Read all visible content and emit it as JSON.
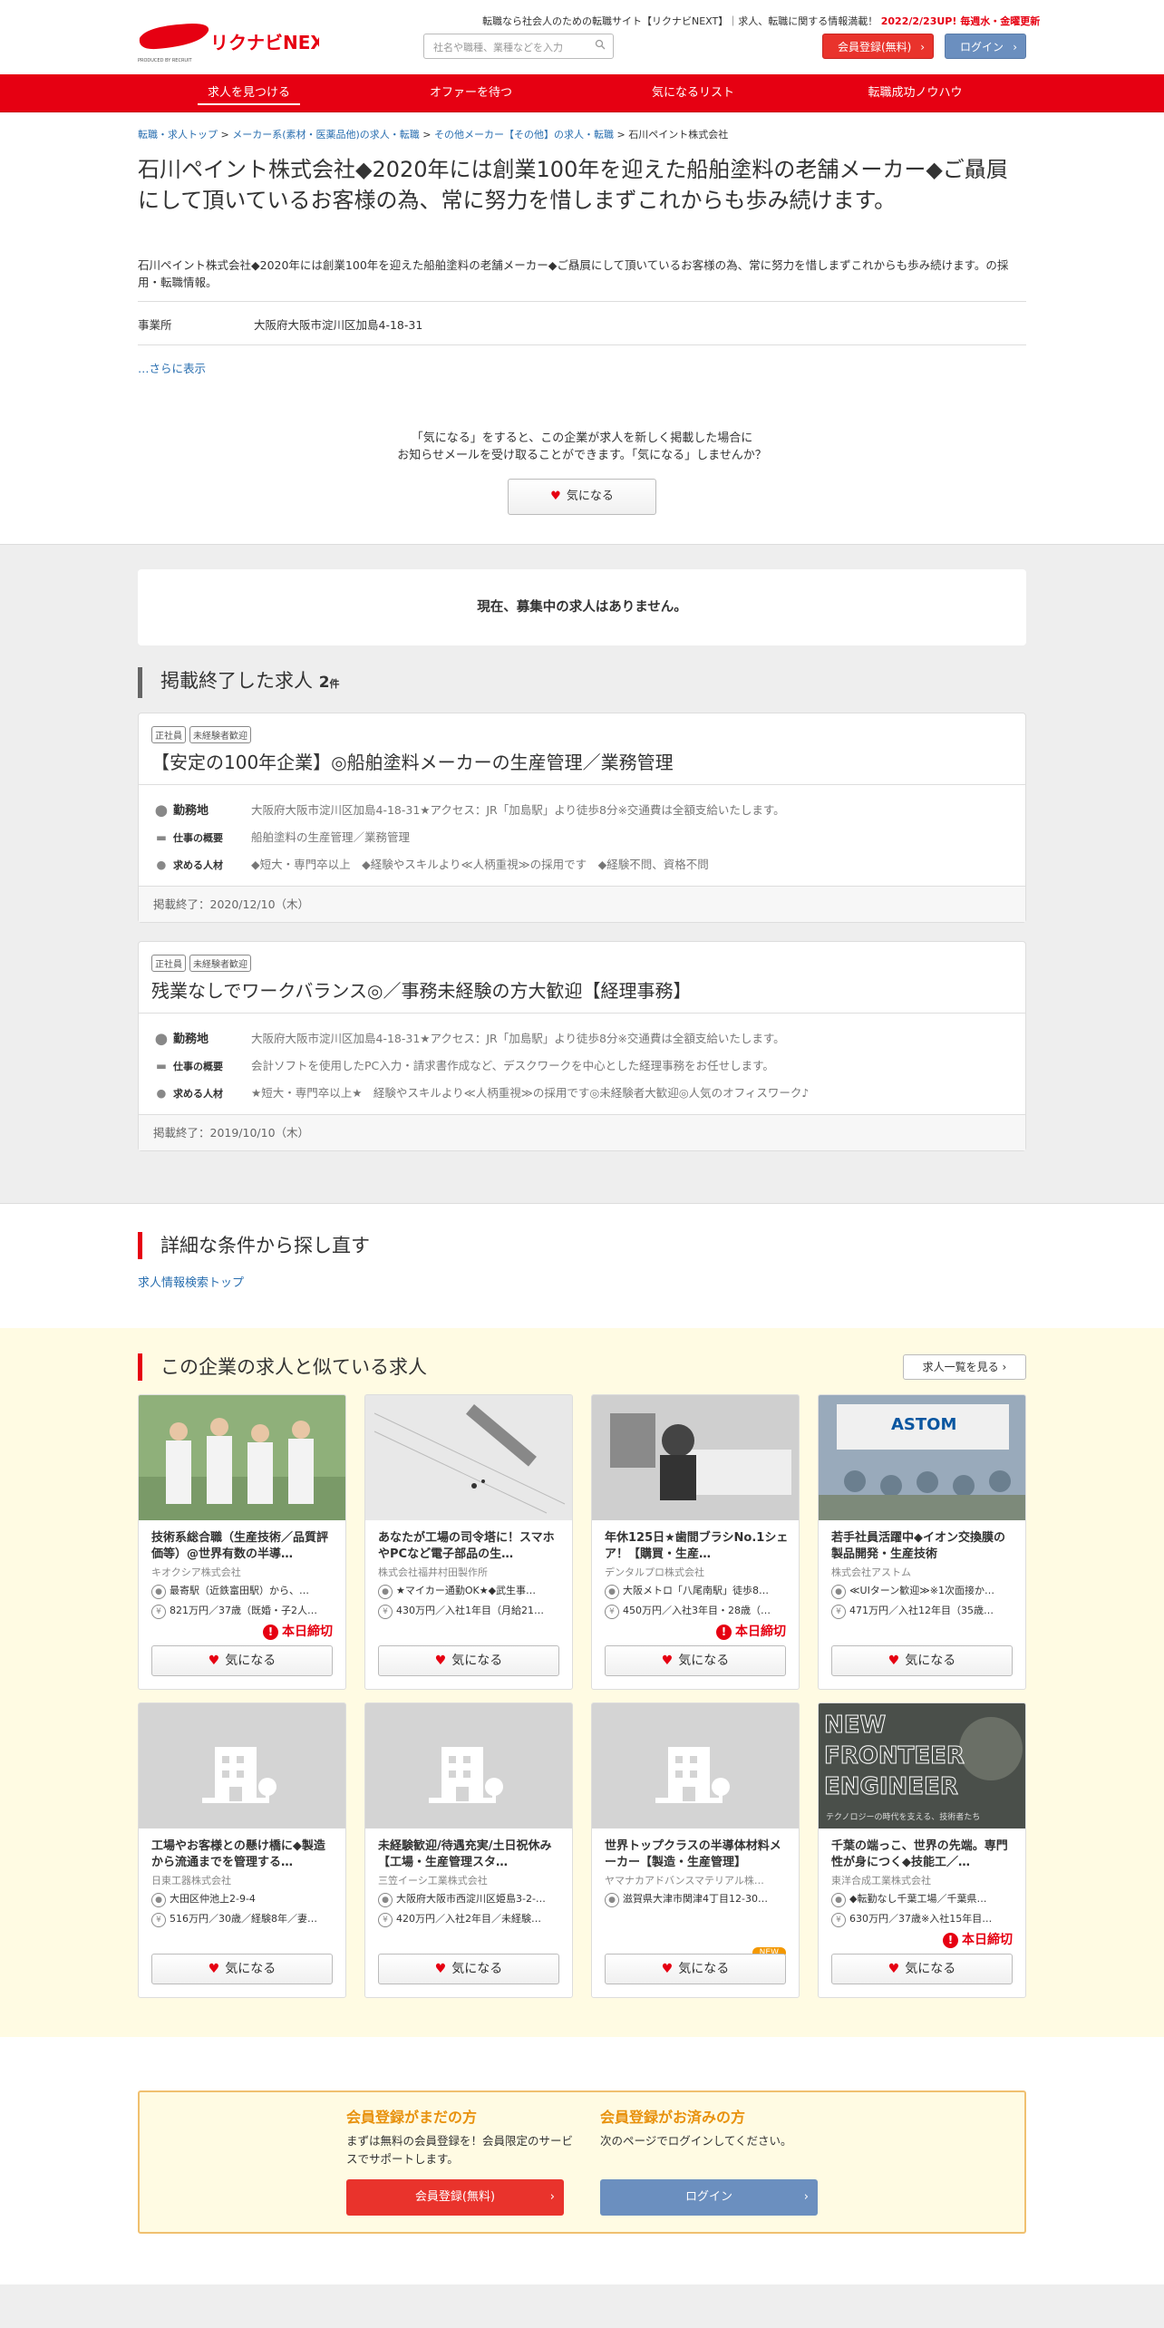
{
  "header": {
    "logo_text": "リクナビNEXT",
    "logo_sub": "PRODUCED BY RECRUIT",
    "tagline": "転職なら社会人のための転職サイト【リクナビNEXT】｜求人、転職に関する情報満載！",
    "update_note": "2022/2/23UP! 毎週水・金曜更新",
    "search_placeholder": "社名や職種、業種などを入力",
    "register_label": "会員登録(無料)",
    "login_label": "ログイン"
  },
  "nav": [
    {
      "label": "求人を見つける",
      "active": true
    },
    {
      "label": "オファーを待つ",
      "active": false
    },
    {
      "label": "気になるリスト",
      "active": false
    },
    {
      "label": "転職成功ノウハウ",
      "active": false
    }
  ],
  "breadcrumb": [
    "転職・求人トップ",
    "メーカー系(素材・医薬品他)の求人・転職",
    "その他メーカー【その他】の求人・転職",
    "石川ペイント株式会社"
  ],
  "company": {
    "title": "石川ペイント株式会社◆2020年には創業100年を迎えた船舶塗料の老舗メーカー◆ご贔屓にして頂いているお客様の為、常に努力を惜しまずこれからも歩み続けます。",
    "subtitle": "石川ペイント株式会社◆2020年には創業100年を迎えた船舶塗料の老舗メーカー◆ご贔屓にして頂いているお客様の為、常に努力を惜しまずこれからも歩み続けます。の採用・転職情報。",
    "office_label": "事業所",
    "office_value": "大阪府大阪市淀川区加島4-18-31",
    "more_label": "…さらに表示"
  },
  "favorite_prompt": {
    "line1": "「気になる」をすると、この企業が求人を新しく掲載した場合に",
    "line2": "お知らせメールを受け取ることができます。「気になる」しませんか？",
    "button": "気になる"
  },
  "no_jobs": "現在、募集中の求人はありません。",
  "ended": {
    "heading": "掲載終了した求人",
    "count": "2",
    "unit": "件",
    "jobs": [
      {
        "tags": [
          "正社員",
          "未経験者歓迎"
        ],
        "title": "【安定の100年企業】◎船舶塗料メーカーの生産管理／業務管理",
        "loc_label": "勤務地",
        "loc": "大阪府大阪市淀川区加島4-18-31★アクセス：JR「加島駅」より徒歩8分※交通費は全額支給いたします。",
        "desc_label": "仕事の概要",
        "desc": "船舶塗料の生産管理／業務管理",
        "req_label": "求める人材",
        "req": "◆短大・専門卒以上　◆経験やスキルより≪人柄重視≫の採用です　◆経験不問、資格不問",
        "ended": "掲載終了：2020/12/10（木）"
      },
      {
        "tags": [
          "正社員",
          "未経験者歓迎"
        ],
        "title": "残業なしでワークバランス◎／事務未経験の方大歓迎【経理事務】",
        "loc_label": "勤務地",
        "loc": "大阪府大阪市淀川区加島4-18-31★アクセス：JR「加島駅」より徒歩8分※交通費は全額支給いたします。",
        "desc_label": "仕事の概要",
        "desc": "会計ソフトを使用したPC入力・請求書作成など、デスクワークを中心とした経理事務をお任せします。",
        "req_label": "求める人材",
        "req": "★短大・専門卒以上★　経験やスキルより≪人柄重視≫の採用です◎未経験者大歓迎◎人気のオフィスワーク♪",
        "ended": "掲載終了：2019/10/10（木）"
      }
    ]
  },
  "refine": {
    "heading": "詳細な条件から探し直す",
    "link": "求人情報検索トップ"
  },
  "similar": {
    "heading": "この企業の求人と似ている求人",
    "list_button": "求人一覧を見る",
    "fav_label": "気になる",
    "deadline_label": "本日締切",
    "new_label": "NEW",
    "jobs": [
      {
        "title": "技術系総合職（生産技術／品質評価等）@世界有数の半導…",
        "company": "キオクシア株式会社",
        "loc": "最寄駅（近鉄富田駅）から、…",
        "salary": "821万円／37歳（既婚・子2人…",
        "deadline": true,
        "new": false,
        "img": "people"
      },
      {
        "title": "あなたが工場の司令塔に！スマホやPCなど電子部品の生…",
        "company": "株式会社福井村田製作所",
        "loc": "★マイカー通勤OK★◆武生事…",
        "salary": "430万円／入社1年目（月給21…",
        "deadline": false,
        "new": false,
        "img": "pen"
      },
      {
        "title": "年休125日★歯間ブラシNo.1シェア！【購買・生産…",
        "company": "デンタルプロ株式会社",
        "loc": "大阪メトロ「八尾南駅」徒歩8…",
        "salary": "450万円／入社3年目・28歳（…",
        "deadline": true,
        "new": false,
        "img": "office"
      },
      {
        "title": "若手社員活躍中◆イオン交換膜の製品開発・生産技術",
        "company": "株式会社アストム",
        "loc": "≪UIターン歓迎≫※1次面接か…",
        "salary": "471万円／入社12年目（35歳…",
        "deadline": false,
        "new": false,
        "img": "astom",
        "sign": "ASTOM"
      },
      {
        "title": "工場やお客様との懸け橋に◆製造から流通までを管理する…",
        "company": "日東工器株式会社",
        "loc": "大田区仲池上2-9-4",
        "salary": "516万円／30歳／経験8年／妻…",
        "deadline": false,
        "new": false,
        "img": "building"
      },
      {
        "title": "未経験歓迎/待遇充実/土日祝休み【工場・生産管理スタ…",
        "company": "三笠イーシ工業株式会社",
        "loc": "大阪府大阪市西淀川区姫島3-2-…",
        "salary": "420万円／入社2年目／未経験…",
        "deadline": false,
        "new": false,
        "img": "building"
      },
      {
        "title": "世界トップクラスの半導体材料メーカー【製造・生産管理】",
        "company": "ヤマナカアドバンスマテリアル株…",
        "loc": "滋賀県大津市関津4丁目12-30…",
        "salary": "",
        "deadline": false,
        "new": true,
        "img": "building"
      },
      {
        "title": "千葉の端っこ、世界の先端。専門性が身につく◆技能工／…",
        "company": "東洋合成工業株式会社",
        "loc": "◆転勤なし千葉工場／千葉県…",
        "salary": "630万円／37歳※入社15年目…",
        "deadline": true,
        "new": false,
        "img": "engineer",
        "banner": [
          "NEW",
          "FRONTEER",
          "ENGINEER"
        ],
        "caption": "テクノロジーの時代を支える、技術者たち"
      }
    ]
  },
  "member": {
    "new_heading": "会員登録がまだの方",
    "new_text": "まずは無料の会員登録を！会員限定のサービスでサポートします。",
    "new_button": "会員登録(無料)",
    "existing_heading": "会員登録がお済みの方",
    "existing_text": "次のページでログインしてください。",
    "existing_button": "ログイン"
  },
  "colors": {
    "brand_red": "#e60012",
    "link_blue": "#2a6fb0",
    "login_blue": "#6b8fbf",
    "accent_orange": "#e8920e"
  }
}
